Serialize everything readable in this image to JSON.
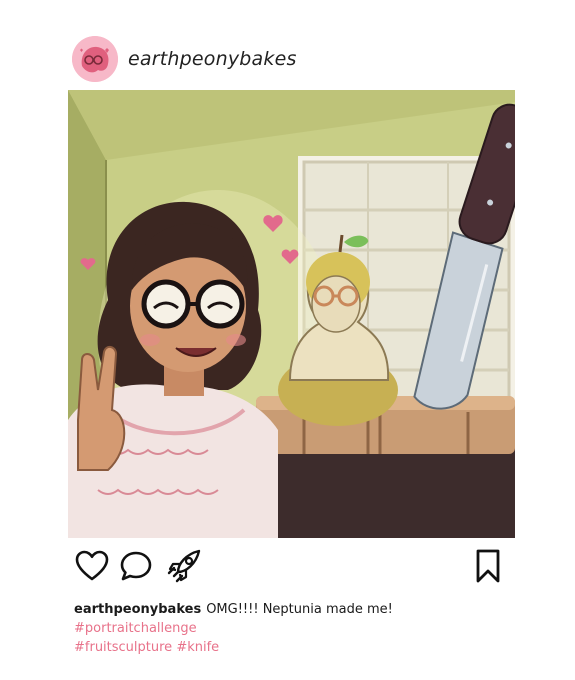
{
  "post": {
    "username": "earthpeonybakes",
    "caption_user": "earthpeonybakes",
    "caption_text": "OMG!!!! Neptunia made me!",
    "hashtags": [
      "#portraitchallenge",
      "#fruitsculpture",
      "#knife"
    ]
  },
  "actions": {
    "like_icon": "heart-outline-icon",
    "comment_icon": "speech-bubble-icon",
    "share_icon": "rocket-icon",
    "save_icon": "bookmark-icon"
  },
  "colors": {
    "hashtag": "#e8728a",
    "avatar_bg": "#f7b8c8",
    "wall": "#c9cf8a",
    "counter": "#3a2a2a"
  }
}
